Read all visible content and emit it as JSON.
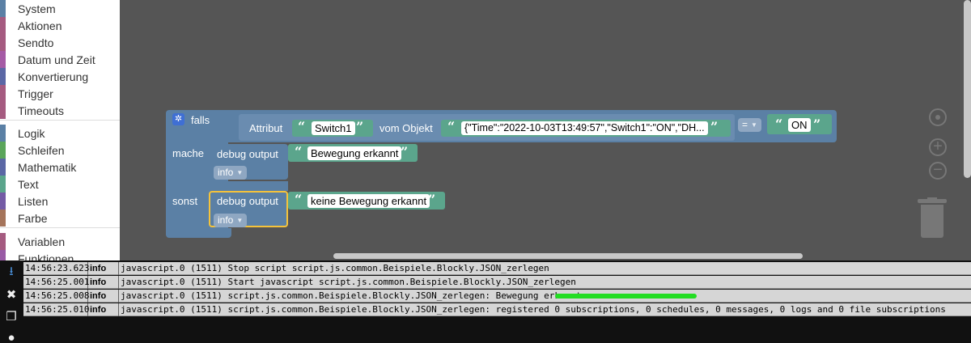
{
  "toolbox": {
    "items": [
      {
        "label": "System",
        "color": "#5b80a5"
      },
      {
        "label": "Aktionen",
        "color": "#a55b80"
      },
      {
        "label": "Sendto",
        "color": "#a55b80"
      },
      {
        "label": "Datum und Zeit",
        "color": "#a55ba5"
      },
      {
        "label": "Konvertierung",
        "color": "#5b67a5"
      },
      {
        "label": "Trigger",
        "color": "#a55b80"
      },
      {
        "label": "Timeouts",
        "color": "#a55b80"
      },
      {
        "label": "Logik",
        "color": "#5b80a5"
      },
      {
        "label": "Schleifen",
        "color": "#5ba55b"
      },
      {
        "label": "Mathematik",
        "color": "#5b67a5"
      },
      {
        "label": "Text",
        "color": "#5ba58c"
      },
      {
        "label": "Listen",
        "color": "#745ba5"
      },
      {
        "label": "Farbe",
        "color": "#a5745b"
      },
      {
        "label": "Variablen",
        "color": "#a55b80"
      },
      {
        "label": "Funktionen",
        "color": "#995ba5"
      }
    ]
  },
  "blocks": {
    "if_block": {
      "falls_label": "falls",
      "mache_label": "mache",
      "sonst_label": "sonst"
    },
    "condition": {
      "attribut_label": "Attribut",
      "attribute_value": "Switch1",
      "vom_objekt_label": "vom Objekt",
      "object_value": "{\"Time\":\"2022-10-03T13:49:57\",\"Switch1\":\"ON\",\"DH...",
      "operator": "=",
      "compare_value": "ON"
    },
    "debug1": {
      "label": "debug output",
      "level": "info",
      "text": "Bewegung erkannt"
    },
    "debug2": {
      "label": "debug output",
      "level": "info",
      "text": "keine Bewegung erkannt"
    }
  },
  "log": {
    "rows": [
      {
        "time": "14:56:23.623",
        "level": "info",
        "message": "javascript.0 (1511) Stop script script.js.common.Beispiele.Blockly.JSON_zerlegen"
      },
      {
        "time": "14:56:25.001",
        "level": "info",
        "message": "javascript.0 (1511) Start javascript script.js.common.Beispiele.Blockly.JSON_zerlegen"
      },
      {
        "time": "14:56:25.008",
        "level": "info",
        "message": "javascript.0 (1511) script.js.common.Beispiele.Blockly.JSON_zerlegen: Bewegung erkannt"
      },
      {
        "time": "14:56:25.010",
        "level": "info",
        "message": "javascript.0 (1511) script.js.common.Beispiele.Blockly.JSON_zerlegen: registered 0 subscriptions, 0 schedules, 0 messages, 0 logs and 0 file subscriptions"
      }
    ]
  }
}
